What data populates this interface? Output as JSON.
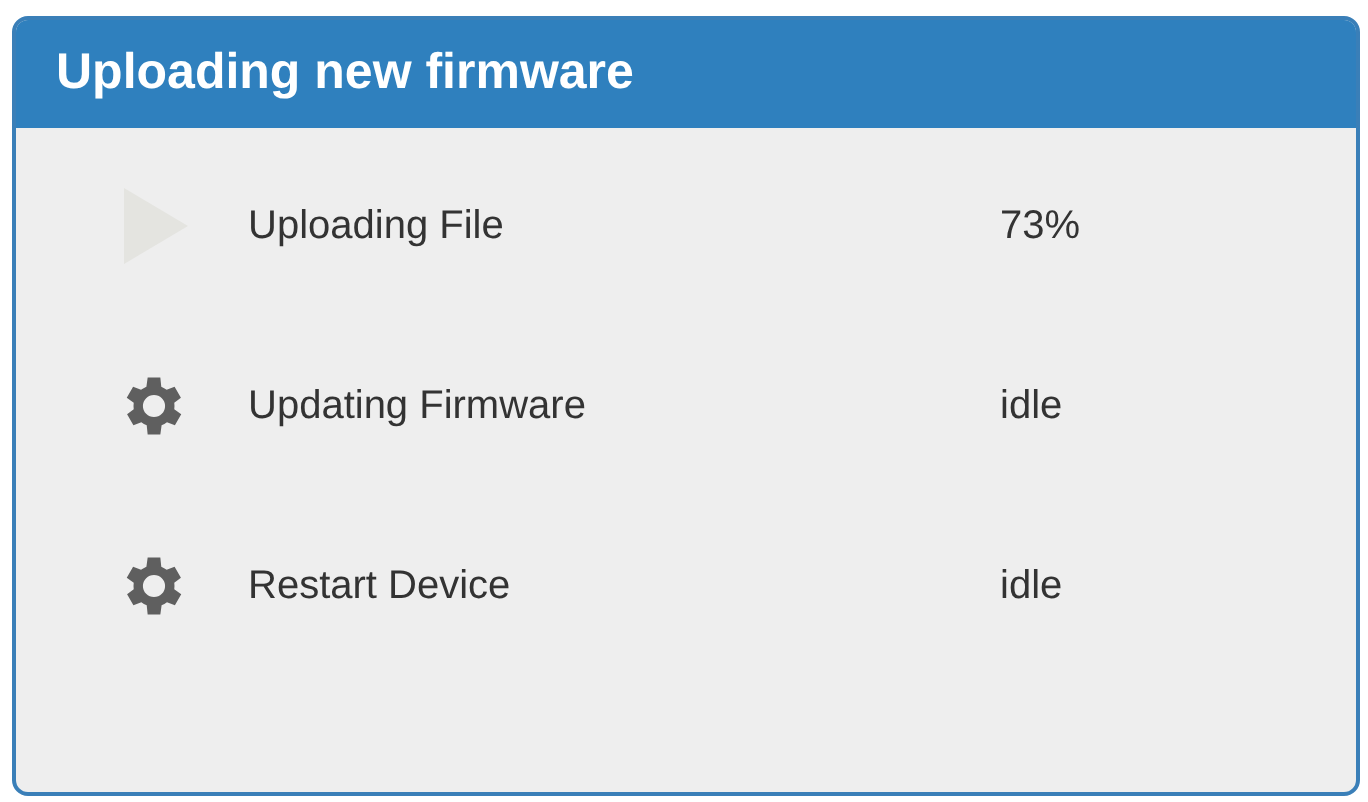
{
  "panel": {
    "title": "Uploading new firmware"
  },
  "steps": [
    {
      "kind": "active",
      "label": "Uploading File",
      "status": "73%"
    },
    {
      "kind": "pending",
      "label": "Updating Firmware",
      "status": "idle"
    },
    {
      "kind": "pending",
      "label": "Restart Device",
      "status": "idle"
    }
  ]
}
